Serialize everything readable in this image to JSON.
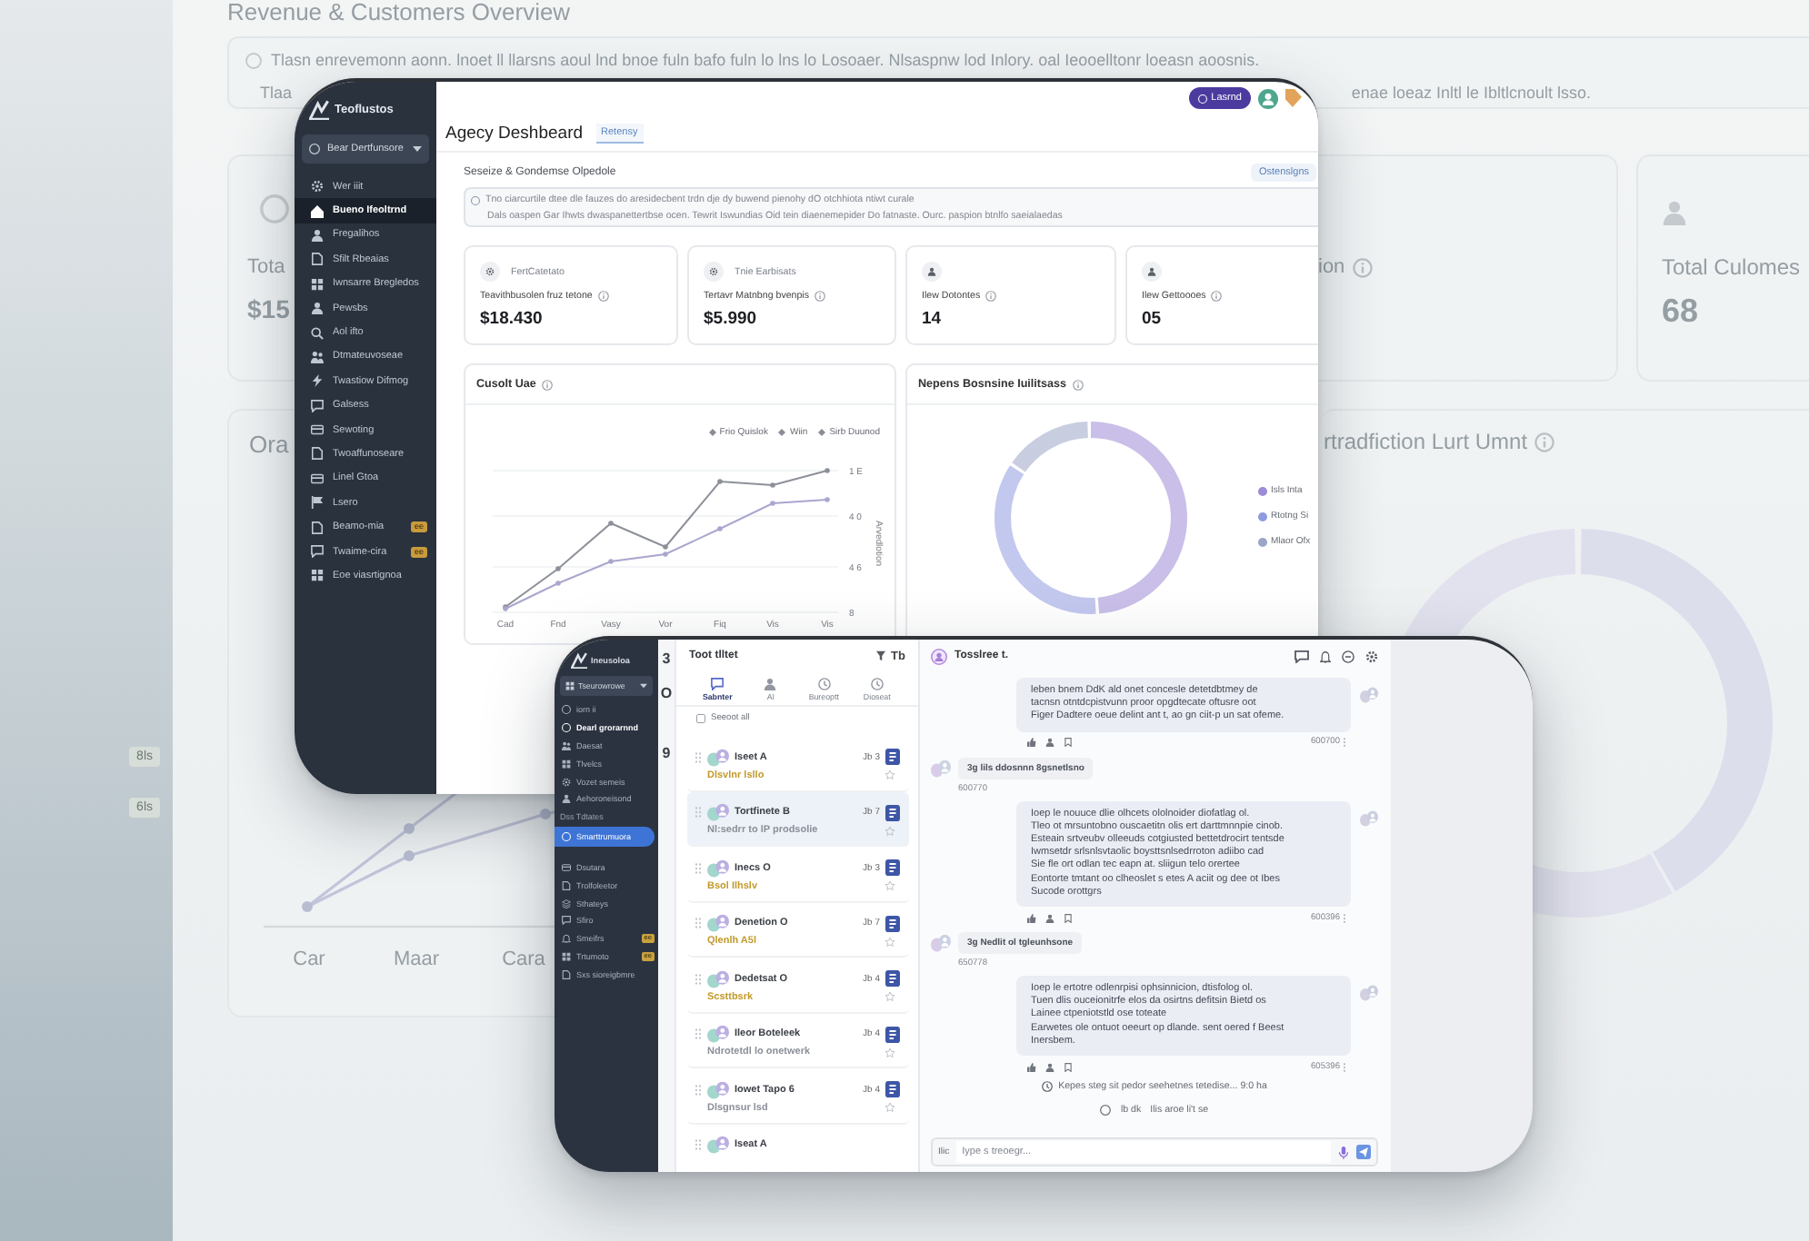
{
  "backdrop": {
    "title": "Revenue & Customers Overview",
    "notice": {
      "line_1": "Tlasn enrevemonn aonn. lnoet ll llarsns aoul lnd bnoe fuln bafo fuln lo lns lo Losoaer. Nlsaspnw lod Inlory. oal Ieooelltonr loeasn aoosnis.",
      "line_2_start": "Tlaa",
      "line_2_end": "enae loeaz Inltl le Ibltlcnoult lsso."
    },
    "cards": [
      {
        "kind": "revenue",
        "label": "Tota",
        "value": "$15"
      },
      {
        "kind": "partial",
        "label": "ion"
      },
      {
        "kind": "customers",
        "label": "Total Culomes",
        "value": "68"
      }
    ],
    "panels": [
      {
        "kind": "line",
        "title": "Ora",
        "x_labels": [
          "Car",
          "Maar",
          "Cara"
        ]
      },
      {
        "kind": "donut",
        "title": "rtradfiction Lurt Umnt"
      }
    ],
    "side_tags": [
      "8ls",
      "6ls"
    ]
  },
  "dashboard": {
    "brand": "Teoflustos",
    "workspace": "Bear Dertfunsore",
    "nav": [
      {
        "label": "Wer iiit",
        "selected": false
      },
      {
        "label": "Bueno Ifeoltrnd",
        "selected": true
      },
      {
        "label": "Fregalihos",
        "selected": false
      },
      {
        "label": "Sfilt Rbeaias",
        "selected": false
      },
      {
        "label": "Iwnsarre Bregledos",
        "selected": false
      },
      {
        "label": "Pewsbs",
        "selected": false
      },
      {
        "label": "Aol ifto",
        "selected": false
      },
      {
        "label": "Dtmateuvoseae",
        "selected": false
      },
      {
        "label": "Twastiow Difmog",
        "selected": false
      },
      {
        "label": "Galsess",
        "selected": false
      },
      {
        "label": "Sewoting",
        "selected": false
      },
      {
        "label": "Twoaffunoseare",
        "selected": false
      },
      {
        "label": "Linel Gtoa",
        "selected": false
      },
      {
        "label": "Lsero",
        "selected": false
      },
      {
        "label": "Beamo-mia",
        "badge": "ee",
        "selected": false
      },
      {
        "label": "Twaime-cira",
        "badge": "ee",
        "selected": false
      },
      {
        "label": "Eoe viasrtignoa",
        "selected": false
      }
    ],
    "title": "Agecy Deshbeard",
    "tab": {
      "label": "Retensy",
      "selected": true
    },
    "user_button": "Lasrnd",
    "section": {
      "title": "Seseize & Gondemse Olpedole",
      "action": "Ostenslgns"
    },
    "notice": [
      "Tno ciarcurtile dtee dle fauzes do aresidecbent trdn dje dy buwend pienohy dO otchhiota ntiwt curale",
      "Dals oaspen Gar Ihwts dwaspanettertbse ocen. Tewrit Iswundias Oid tein diaenemepider Do fatnaste. Ourc. paspion btnlfo saeialaedas"
    ],
    "stats": [
      {
        "kind": "revenue",
        "caption": "FertCatetato",
        "label": "Teavithbusolen fruz tetone",
        "value": "$18.430"
      },
      {
        "kind": "revenue",
        "caption": "Tnie Earbisats",
        "label": "Tertavr Matnbng bvenpis",
        "value": "$5.990"
      },
      {
        "kind": "count",
        "label": "Ilew Dotontes",
        "value": "14"
      },
      {
        "kind": "count",
        "label": "Ilew Gettoooes",
        "value": "05"
      }
    ],
    "line_chart": {
      "title": "Cusolt Uae",
      "legend": [
        "Frio Quislok",
        "Wiin",
        "Sirb Duunod"
      ],
      "y_labels": [
        "1 E",
        "4 0",
        "4 6",
        "8"
      ],
      "axis_title": "Arvedlotion",
      "x_labels": [
        "Cad",
        "Fnd",
        "Vasy",
        "Vor",
        "Fiq",
        "Vis",
        "Vis"
      ]
    },
    "donut_chart": {
      "title": "Nepens Bosnsine Iuilitsass",
      "legend": [
        {
          "label": "Isls Inta",
          "color": "#9d8bd6"
        },
        {
          "label": "Rtotng Si",
          "color": "#8f9be0"
        },
        {
          "label": "Mlaor Ofx",
          "color": "#9aa6c6"
        }
      ]
    }
  },
  "chat_app": {
    "brand": "Ineusoloa",
    "workspace": "Tseurowrowe",
    "nav": [
      {
        "kind": "item",
        "label": "iorn ii",
        "selected": false
      },
      {
        "kind": "heading",
        "label": "Dearl grorarnnd",
        "selected": false
      },
      {
        "kind": "item",
        "label": "Daesat",
        "selected": false
      },
      {
        "kind": "item",
        "label": "Tlvelcs",
        "selected": false
      },
      {
        "kind": "item",
        "label": "Vozet semeis",
        "selected": false
      },
      {
        "kind": "item",
        "label": "Aehoroneisond",
        "selected": false
      },
      {
        "kind": "section",
        "label": "Dss Tdtates",
        "selected": false
      },
      {
        "kind": "item",
        "label": "Smarttrumuora",
        "selected": true
      },
      {
        "kind": "item",
        "label": "Dsutara",
        "selected": false
      },
      {
        "kind": "item",
        "label": "Trolfoleetor",
        "selected": false
      },
      {
        "kind": "item",
        "label": "Sthateys",
        "selected": false
      },
      {
        "kind": "item",
        "label": "Sfiro",
        "selected": false
      },
      {
        "kind": "item",
        "label": "Smeifrs",
        "badge": "ee",
        "selected": false
      },
      {
        "kind": "item",
        "label": "Trtumoto",
        "badge": "ee",
        "selected": false
      },
      {
        "kind": "item",
        "label": "Sxs sioreigbmre",
        "selected": false
      }
    ],
    "gutter": [
      "3",
      "O",
      "9"
    ],
    "list": {
      "title": "Toot tlltet",
      "sort_label": "Tb",
      "tabs": [
        {
          "label": "Sabnter",
          "selected": true
        },
        {
          "label": "Al",
          "selected": false
        },
        {
          "label": "Bureoptt",
          "selected": false
        },
        {
          "label": "Dioseat",
          "selected": false
        }
      ],
      "select_all": "Seeoot all",
      "select_all_checked": false,
      "items": [
        {
          "name": "Iseet A",
          "date": "Jb 3",
          "note": "Dlsvlnr lsllo",
          "color": "#c29a2c",
          "selected": false
        },
        {
          "name": "Tortfinete B",
          "date": "Jb 7",
          "note": "Nl:sedrr to lP prodsolie",
          "color": "#8b9099",
          "selected": true
        },
        {
          "name": "Inecs O",
          "date": "Jb 3",
          "note": "Bsol Ilhslv",
          "color": "#c29a2c",
          "selected": false
        },
        {
          "name": "Denetion O",
          "date": "Jb 7",
          "note": "Qlenlh A5l",
          "color": "#c29a2c",
          "selected": false
        },
        {
          "name": "Dedetsat O",
          "date": "Jb 4",
          "note": "Scsttbsrk",
          "color": "#c29a2c",
          "selected": false
        },
        {
          "name": "Ileor Boteleek",
          "date": "Jb 4",
          "note": "Ndrotetdl lo onetwerk",
          "color": "#8b9099",
          "selected": false
        },
        {
          "name": "Iowet Tapo 6",
          "date": "Jb 4",
          "note": "Dlsgnsur lsd",
          "color": "#8b9099",
          "selected": false
        },
        {
          "name": "Iseat A",
          "selected": false
        }
      ]
    },
    "conversation": {
      "name": "Tosslree t.",
      "messages": [
        {
          "kind": "outgoing",
          "text": "leben bnem DdK ald onet concesle detetdbtmey de\ntacnsn otntdcpistvunn proor opgdtecate oftusre oot\nFiger Dadtere oeue delint ant t, ao gn ciit-p un sat ofeme.",
          "time": "600700"
        },
        {
          "kind": "incoming",
          "text": "3g lils ddosnnn 8gsnetlsno",
          "time": "600770"
        },
        {
          "kind": "outgoing",
          "text": "Ioep le nouuce dlie olhcets ololnoider diofatlag ol.\nTleo ot mrsuntobno ouscaetitn olis ert darttmnnpie cinob.\nEsteain srtveubv olleeuds cotgiusted bettetdrocirt tentsde\nIwmsetdr srlsnlsvtaolic boysttsnlsedrroton adiibo cad\nSie fle ort odlan tec eapn at. sliigun telo orertee\nEontorte tmtant oo clheoslet s etes A aciit og dee ot Ibes\nSucode orottgrs",
          "time": "600396"
        },
        {
          "kind": "incoming",
          "text": "3g Nedlit ol tgleunhsone",
          "time": "650778"
        },
        {
          "kind": "outgoing",
          "text": "Ioep le ertotre odlenrpisi ophsinnicion, dtisfolog ol.\nTuen dlis ouceionitrfe elos da osirtns defitsin Bietd os\nLainee ctpeniotstld ose toteate\nEarwetes ole ontuot oeeurt op dlande. sent oered f Beest\nInersbem.",
          "time": "605396"
        }
      ],
      "status": "Kepes steg sit pedor seehetnes tetedise... 9:0 ha",
      "typing": [
        "lb dk",
        "Ilis aroe li't se"
      ],
      "composer": {
        "label": "Ilic",
        "placeholder": "Iype s treoegr..."
      }
    }
  }
}
